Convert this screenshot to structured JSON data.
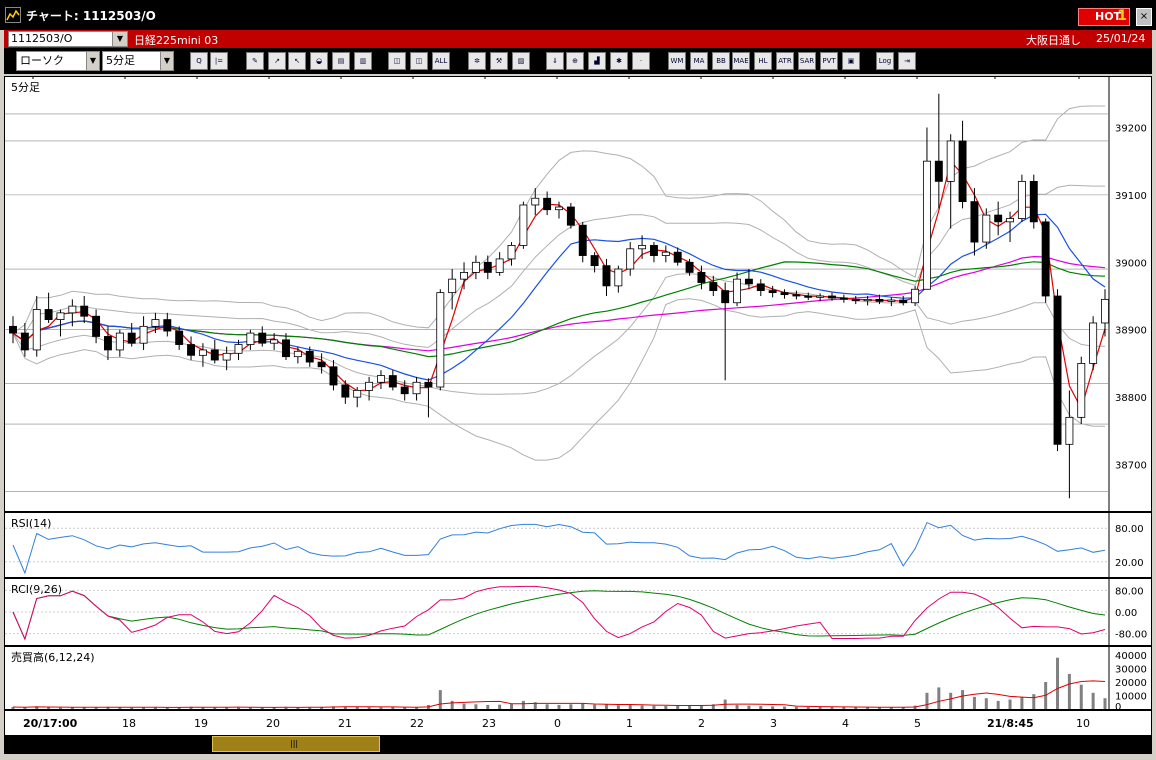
{
  "window": {
    "title": "チャート: 1112503/O",
    "hot_label": "HOT",
    "hot_number": "1",
    "close_label": "×"
  },
  "infobar": {
    "symbol_code": "1112503/O",
    "symbol_name": "日経225mini 03",
    "market": "大阪日通し",
    "date": "25/01/24"
  },
  "toolbar": {
    "chart_type": "ローソク",
    "interval": "5分足",
    "buttons": [
      {
        "name": "search-button",
        "label": "Q"
      },
      {
        "name": "period-button",
        "label": "|="
      },
      {
        "name": "pencil-button",
        "label": "✎"
      },
      {
        "name": "trendline-button",
        "label": "↗"
      },
      {
        "name": "cursor-button",
        "label": "↖"
      },
      {
        "name": "fill-button",
        "label": "◒"
      },
      {
        "name": "notes-button",
        "label": "▤"
      },
      {
        "name": "delete-button",
        "label": "▥"
      },
      {
        "name": "candle-button",
        "label": "◫"
      },
      {
        "name": "candle2-button",
        "label": "◫"
      },
      {
        "name": "all-button",
        "label": "ALL"
      },
      {
        "name": "settings-button",
        "label": "✲"
      },
      {
        "name": "tool-button",
        "label": "⚒"
      },
      {
        "name": "color-button",
        "label": "▨"
      },
      {
        "name": "down-button",
        "label": "⇓"
      },
      {
        "name": "zoom-button",
        "label": "⊕"
      },
      {
        "name": "chart-button",
        "label": "▟"
      },
      {
        "name": "compare-button",
        "label": "✱"
      },
      {
        "name": "disabled-button",
        "label": "·"
      },
      {
        "name": "wma-button",
        "label": "WM"
      },
      {
        "name": "ma-button",
        "label": "MA"
      },
      {
        "name": "bb-button",
        "label": "BB"
      },
      {
        "name": "mae-button",
        "label": "MAE"
      },
      {
        "name": "hl-button",
        "label": "HL"
      },
      {
        "name": "atr-button",
        "label": "ATR"
      },
      {
        "name": "sar-button",
        "label": "SAR"
      },
      {
        "name": "pvt-button",
        "label": "PVT"
      },
      {
        "name": "window-button",
        "label": "▣"
      },
      {
        "name": "log-button",
        "label": "Log"
      },
      {
        "name": "exit-button",
        "label": "⇥"
      }
    ]
  },
  "panels": {
    "main_label": "5分足",
    "rsi_label": "RSI(14)",
    "rci_label": "RCI(9,26)",
    "volume_label": "売買高(6,12,24)"
  },
  "axes": {
    "price_ticks": [
      "39200",
      "39100",
      "39000",
      "38900",
      "38800",
      "38700"
    ],
    "rsi_ticks": [
      "80.00",
      "20.00"
    ],
    "rci_ticks": [
      "80.00",
      "0.00",
      "-80.00"
    ],
    "volume_ticks": [
      "40000",
      "30000",
      "20000",
      "10000",
      "0"
    ],
    "time_ticks": [
      "20/17:00",
      "18",
      "19",
      "20",
      "21",
      "22",
      "23",
      "0",
      "1",
      "2",
      "3",
      "4",
      "5",
      "21/8:45",
      "10"
    ]
  },
  "colors": {
    "candle_up": "#ffffff",
    "candle_down": "#000000",
    "ma_short": "#e00000",
    "ma_mid": "#1a50e8",
    "ma_long": "#008000",
    "ma_xlong": "#e000e0",
    "bollinger": "#b0b0b0",
    "rsi": "#3080e0",
    "rci_fast": "#e00070",
    "rci_slow": "#008000",
    "volume": "#808080"
  },
  "chart_data": {
    "type": "candlestick",
    "ylim": [
      38640,
      39260
    ],
    "candles": [
      {
        "o": 38905,
        "h": 38920,
        "l": 38880,
        "c": 38895
      },
      {
        "o": 38895,
        "h": 38910,
        "l": 38860,
        "c": 38870
      },
      {
        "o": 38870,
        "h": 38950,
        "l": 38860,
        "c": 38930
      },
      {
        "o": 38930,
        "h": 38955,
        "l": 38910,
        "c": 38915
      },
      {
        "o": 38915,
        "h": 38930,
        "l": 38890,
        "c": 38925
      },
      {
        "o": 38925,
        "h": 38945,
        "l": 38905,
        "c": 38935
      },
      {
        "o": 38935,
        "h": 38950,
        "l": 38910,
        "c": 38920
      },
      {
        "o": 38920,
        "h": 38930,
        "l": 38880,
        "c": 38890
      },
      {
        "o": 38890,
        "h": 38905,
        "l": 38855,
        "c": 38870
      },
      {
        "o": 38870,
        "h": 38900,
        "l": 38860,
        "c": 38895
      },
      {
        "o": 38895,
        "h": 38910,
        "l": 38875,
        "c": 38880
      },
      {
        "o": 38880,
        "h": 38920,
        "l": 38870,
        "c": 38905
      },
      {
        "o": 38905,
        "h": 38925,
        "l": 38895,
        "c": 38915
      },
      {
        "o": 38915,
        "h": 38925,
        "l": 38890,
        "c": 38898
      },
      {
        "o": 38898,
        "h": 38905,
        "l": 38870,
        "c": 38878
      },
      {
        "o": 38878,
        "h": 38890,
        "l": 38855,
        "c": 38862
      },
      {
        "o": 38862,
        "h": 38880,
        "l": 38845,
        "c": 38870
      },
      {
        "o": 38870,
        "h": 38885,
        "l": 38850,
        "c": 38855
      },
      {
        "o": 38855,
        "h": 38875,
        "l": 38840,
        "c": 38865
      },
      {
        "o": 38865,
        "h": 38885,
        "l": 38855,
        "c": 38878
      },
      {
        "o": 38878,
        "h": 38900,
        "l": 38870,
        "c": 38895
      },
      {
        "o": 38895,
        "h": 38905,
        "l": 38875,
        "c": 38880
      },
      {
        "o": 38880,
        "h": 38895,
        "l": 38870,
        "c": 38885
      },
      {
        "o": 38885,
        "h": 38895,
        "l": 38855,
        "c": 38860
      },
      {
        "o": 38860,
        "h": 38875,
        "l": 38850,
        "c": 38868
      },
      {
        "o": 38868,
        "h": 38875,
        "l": 38845,
        "c": 38852
      },
      {
        "o": 38852,
        "h": 38865,
        "l": 38835,
        "c": 38845
      },
      {
        "o": 38845,
        "h": 38855,
        "l": 38810,
        "c": 38818
      },
      {
        "o": 38818,
        "h": 38825,
        "l": 38790,
        "c": 38800
      },
      {
        "o": 38800,
        "h": 38815,
        "l": 38785,
        "c": 38810
      },
      {
        "o": 38810,
        "h": 38830,
        "l": 38795,
        "c": 38822
      },
      {
        "o": 38822,
        "h": 38840,
        "l": 38812,
        "c": 38832
      },
      {
        "o": 38832,
        "h": 38840,
        "l": 38810,
        "c": 38815
      },
      {
        "o": 38815,
        "h": 38825,
        "l": 38795,
        "c": 38805
      },
      {
        "o": 38805,
        "h": 38830,
        "l": 38795,
        "c": 38822
      },
      {
        "o": 38822,
        "h": 38828,
        "l": 38770,
        "c": 38815
      },
      {
        "o": 38815,
        "h": 38960,
        "l": 38810,
        "c": 38955
      },
      {
        "o": 38955,
        "h": 38990,
        "l": 38930,
        "c": 38975
      },
      {
        "o": 38975,
        "h": 39000,
        "l": 38960,
        "c": 38985
      },
      {
        "o": 38985,
        "h": 39010,
        "l": 38975,
        "c": 39000
      },
      {
        "o": 39000,
        "h": 39010,
        "l": 38975,
        "c": 38985
      },
      {
        "o": 38985,
        "h": 39015,
        "l": 38980,
        "c": 39005
      },
      {
        "o": 39005,
        "h": 39030,
        "l": 38995,
        "c": 39025
      },
      {
        "o": 39025,
        "h": 39090,
        "l": 39020,
        "c": 39085
      },
      {
        "o": 39085,
        "h": 39110,
        "l": 39070,
        "c": 39095
      },
      {
        "o": 39095,
        "h": 39105,
        "l": 39070,
        "c": 39078
      },
      {
        "o": 39078,
        "h": 39090,
        "l": 39065,
        "c": 39082
      },
      {
        "o": 39082,
        "h": 39088,
        "l": 39050,
        "c": 39055
      },
      {
        "o": 39055,
        "h": 39060,
        "l": 39000,
        "c": 39010
      },
      {
        "o": 39010,
        "h": 39015,
        "l": 38985,
        "c": 38995
      },
      {
        "o": 38995,
        "h": 39005,
        "l": 38950,
        "c": 38965
      },
      {
        "o": 38965,
        "h": 38995,
        "l": 38955,
        "c": 38990
      },
      {
        "o": 38990,
        "h": 39030,
        "l": 38980,
        "c": 39020
      },
      {
        "o": 39020,
        "h": 39040,
        "l": 39005,
        "c": 39025
      },
      {
        "o": 39025,
        "h": 39030,
        "l": 39000,
        "c": 39010
      },
      {
        "o": 39010,
        "h": 39025,
        "l": 39000,
        "c": 39015
      },
      {
        "o": 39015,
        "h": 39022,
        "l": 38995,
        "c": 39000
      },
      {
        "o": 39000,
        "h": 39005,
        "l": 38980,
        "c": 38985
      },
      {
        "o": 38985,
        "h": 38995,
        "l": 38960,
        "c": 38970
      },
      {
        "o": 38970,
        "h": 38980,
        "l": 38950,
        "c": 38958
      },
      {
        "o": 38958,
        "h": 38970,
        "l": 38825,
        "c": 38940
      },
      {
        "o": 38940,
        "h": 38985,
        "l": 38935,
        "c": 38975
      },
      {
        "o": 38975,
        "h": 38990,
        "l": 38960,
        "c": 38968
      },
      {
        "o": 38968,
        "h": 38975,
        "l": 38950,
        "c": 38958
      },
      {
        "o": 38958,
        "h": 38965,
        "l": 38948,
        "c": 38955
      },
      {
        "o": 38955,
        "h": 38960,
        "l": 38946,
        "c": 38952
      },
      {
        "o": 38952,
        "h": 38958,
        "l": 38945,
        "c": 38950
      },
      {
        "o": 38950,
        "h": 38955,
        "l": 38944,
        "c": 38948
      },
      {
        "o": 38948,
        "h": 38954,
        "l": 38942,
        "c": 38950
      },
      {
        "o": 38950,
        "h": 38955,
        "l": 38943,
        "c": 38947
      },
      {
        "o": 38947,
        "h": 38952,
        "l": 38940,
        "c": 38945
      },
      {
        "o": 38945,
        "h": 38950,
        "l": 38938,
        "c": 38943
      },
      {
        "o": 38943,
        "h": 38950,
        "l": 38936,
        "c": 38945
      },
      {
        "o": 38945,
        "h": 38952,
        "l": 38938,
        "c": 38942
      },
      {
        "o": 38942,
        "h": 38948,
        "l": 38935,
        "c": 38944
      },
      {
        "o": 38944,
        "h": 38950,
        "l": 38936,
        "c": 38940
      },
      {
        "o": 38940,
        "h": 38965,
        "l": 38935,
        "c": 38960
      },
      {
        "o": 38960,
        "h": 39200,
        "l": 38960,
        "c": 39150
      },
      {
        "o": 39150,
        "h": 39250,
        "l": 39080,
        "c": 39120
      },
      {
        "o": 39120,
        "h": 39190,
        "l": 39050,
        "c": 39180
      },
      {
        "o": 39180,
        "h": 39210,
        "l": 39080,
        "c": 39090
      },
      {
        "o": 39090,
        "h": 39110,
        "l": 39010,
        "c": 39030
      },
      {
        "o": 39030,
        "h": 39080,
        "l": 39020,
        "c": 39070
      },
      {
        "o": 39070,
        "h": 39090,
        "l": 39040,
        "c": 39060
      },
      {
        "o": 39060,
        "h": 39075,
        "l": 39030,
        "c": 39065
      },
      {
        "o": 39065,
        "h": 39130,
        "l": 39060,
        "c": 39120
      },
      {
        "o": 39120,
        "h": 39130,
        "l": 39050,
        "c": 39060
      },
      {
        "o": 39060,
        "h": 39065,
        "l": 38940,
        "c": 38950
      },
      {
        "o": 38950,
        "h": 38960,
        "l": 38720,
        "c": 38730
      },
      {
        "o": 38730,
        "h": 38810,
        "l": 38650,
        "c": 38770
      },
      {
        "o": 38770,
        "h": 38860,
        "l": 38760,
        "c": 38850
      },
      {
        "o": 38850,
        "h": 38920,
        "l": 38840,
        "c": 38910
      },
      {
        "o": 38910,
        "h": 38960,
        "l": 38890,
        "c": 38945
      }
    ],
    "volume_max": 40000,
    "volume": [
      1500,
      1200,
      2000,
      1300,
      1000,
      1100,
      1200,
      1400,
      1600,
      1100,
      1000,
      1300,
      1200,
      1100,
      1500,
      1700,
      1200,
      1300,
      1400,
      1200,
      1100,
      1000,
      1200,
      1500,
      1300,
      1400,
      1600,
      2000,
      1800,
      1500,
      1300,
      1200,
      1400,
      1300,
      1200,
      3000,
      14000,
      6000,
      4000,
      3500,
      3000,
      3200,
      4000,
      6000,
      5000,
      3500,
      3000,
      3500,
      4000,
      3200,
      3500,
      2800,
      3000,
      2600,
      2400,
      2200,
      2600,
      2800,
      3000,
      3500,
      7000,
      3000,
      2500,
      2200,
      2000,
      1800,
      1600,
      1500,
      1500,
      1400,
      1400,
      1300,
      1300,
      1200,
      1200,
      1200,
      2500,
      12000,
      16000,
      12000,
      14000,
      9000,
      8000,
      6000,
      7000,
      9000,
      11000,
      20000,
      38000,
      26000,
      18000,
      12000,
      8000
    ]
  }
}
